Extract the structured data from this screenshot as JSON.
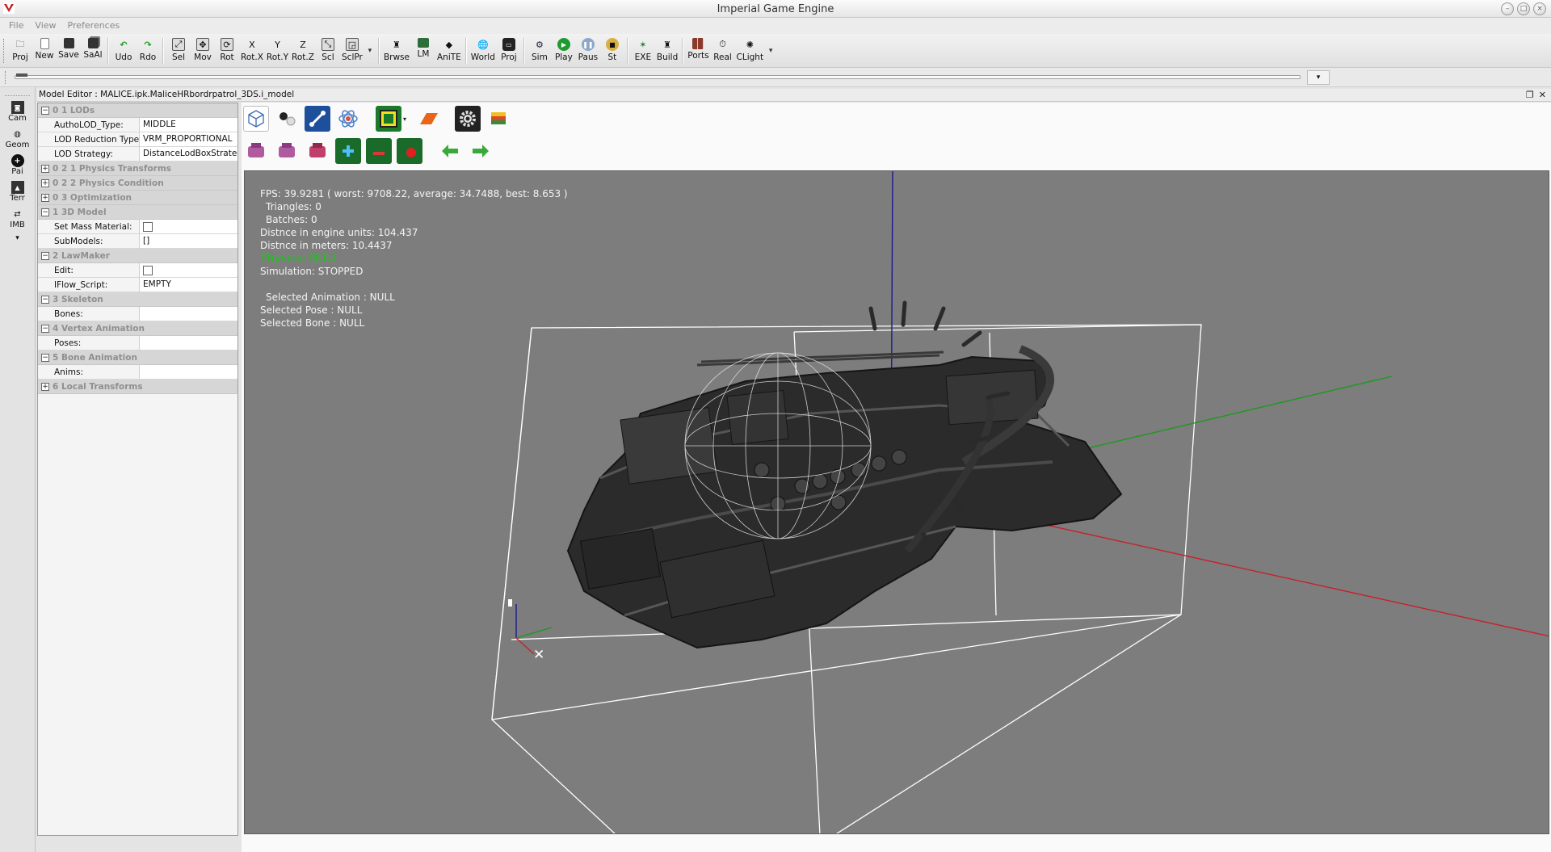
{
  "window": {
    "title": "Imperial Game Engine"
  },
  "menu": [
    "File",
    "View",
    "Preferences"
  ],
  "toolbar": {
    "buttons": [
      "Proj",
      "New",
      "Save",
      "SaAl",
      "Udo",
      "Rdo",
      "Sel",
      "Mov",
      "Rot",
      "Rot.X",
      "Rot.Y",
      "Rot.Z",
      "Scl",
      "SclPr",
      "Brwse",
      "LM",
      "AniTE",
      "World",
      "Proj",
      "Sim",
      "Play",
      "Paus",
      "St",
      "EXE",
      "Build",
      "Ports",
      "Real",
      "CLight"
    ]
  },
  "left_strip": [
    "Cam",
    "Geom",
    "Pai",
    "Terr",
    "IMB"
  ],
  "editor": {
    "title": "Model Editor : MALICE.ipk.MaliceHRbordrpatrol_3DS.i_model"
  },
  "properties": {
    "g0": "0 1 LODs",
    "autholod_key": "AuthoLOD_Type:",
    "autholod_val": "MIDDLE",
    "lodred_key": "LOD Reduction Type:",
    "lodred_val": "VRM_PROPORTIONAL",
    "lodstrat_key": "LOD Strategy:",
    "lodstrat_val": "DistanceLodBoxStrategy",
    "g1": "0 2 1 Physics Transforms",
    "g2": "0 2 2 Physics Condition",
    "g3": "0 3 Optimization",
    "g4": "1 3D Model",
    "setmass_key": "Set Mass Material:",
    "submodels_key": "SubModels:",
    "submodels_val": "[]",
    "g5": "2 LawMaker",
    "edit_key": "Edit:",
    "iflow_key": "IFlow_Script:",
    "iflow_val": "EMPTY",
    "g6": "3 Skeleton",
    "bones_key": "Bones:",
    "g7": "4 Vertex Animation",
    "poses_key": "Poses:",
    "g8": "5 Bone Animation",
    "anims_key": "Anims:",
    "g9": "6 Local Transforms"
  },
  "stats": {
    "fps": "FPS:  39.9281  ( worst:  9708.22,  average:  34.7488,  best:  8.653  )",
    "triangles": "Triangles:  0",
    "batches": "Batches:  0",
    "dist_units": "Distnce  in  engine  units:  104.437",
    "dist_meters": "Distnce  in  meters:  10.4437",
    "physics": "Physics:  NULL",
    "simulation": "Simulation:  STOPPED",
    "sel_anim": "Selected  Animation  :  NULL",
    "sel_pose": "Selected  Pose  :  NULL",
    "sel_bone": "Selected  Bone  :  NULL"
  },
  "colors": {
    "viewport_bg": "#7d7d7d",
    "axis_x": "#c8202a",
    "axis_y": "#1a9a1a",
    "axis_z": "#1a1a90",
    "physics_text": "#1ec31e"
  }
}
